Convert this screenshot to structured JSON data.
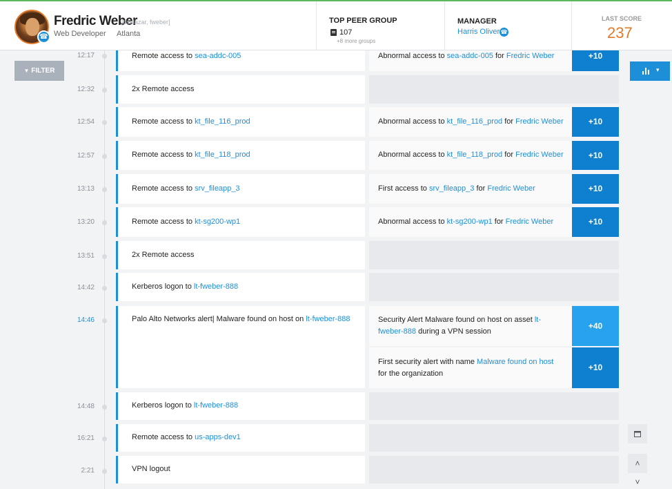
{
  "user": {
    "name": "Fredric Weber",
    "aliases": "[bsalazar, fweber]",
    "role": "Web Developer",
    "location": "Atlanta"
  },
  "peer_group": {
    "title": "TOP PEER GROUP",
    "count": "107",
    "more": "+8 more groups"
  },
  "manager": {
    "title": "MANAGER",
    "name": "Harris Oliver"
  },
  "score": {
    "title": "LAST SCORE",
    "value": "237"
  },
  "filter": {
    "label": "FILTER"
  },
  "events": [
    {
      "time": "12:17",
      "text": "Remote access to ",
      "link": "sea-addc-005"
    },
    {
      "time": "12:32",
      "text": "2x Remote access",
      "link": ""
    },
    {
      "time": "12:54",
      "text": "Remote access to ",
      "link": "kt_file_116_prod"
    },
    {
      "time": "12:57",
      "text": "Remote access to ",
      "link": "kt_file_118_prod"
    },
    {
      "time": "13:13",
      "text": "Remote access to ",
      "link": "srv_fileapp_3"
    },
    {
      "time": "13:20",
      "text": "Remote access to ",
      "link": "kt-sg200-wp1"
    },
    {
      "time": "13:51",
      "text": "2x Remote access",
      "link": ""
    },
    {
      "time": "14:42",
      "text": "Kerberos logon to ",
      "link": "lt-fweber-888"
    },
    {
      "time": "14:46",
      "text": "Palo Alto Networks alert| Malware found on host on ",
      "link": "lt-fweber-888"
    },
    {
      "time": "14:48",
      "text": "Kerberos logon to ",
      "link": "lt-fweber-888"
    },
    {
      "time": "16:21",
      "text": "Remote access to ",
      "link": "us-apps-dev1"
    },
    {
      "time": "2:21",
      "text": "VPN logout",
      "link": ""
    }
  ],
  "alerts": [
    {
      "a": "Abnormal access to ",
      "asset": "sea-addc-005",
      "b": " for ",
      "user": "Fredric Weber",
      "score": "+10"
    },
    {
      "a": "Abnormal access to ",
      "asset": "kt_file_116_prod",
      "b": " for ",
      "user": "Fredric Weber",
      "score": "+10"
    },
    {
      "a": "Abnormal access to ",
      "asset": "kt_file_118_prod",
      "b": " for ",
      "user": "Fredric Weber",
      "score": "+10"
    },
    {
      "a": "First access to ",
      "asset": "srv_fileapp_3",
      "b": " for ",
      "user": "Fredric Weber",
      "score": "+10"
    },
    {
      "a": "Abnormal access to ",
      "asset": "kt-sg200-wp1",
      "b": " for ",
      "user": "Fredric Weber",
      "score": "+10"
    },
    {
      "a": "Security Alert Malware found on host on asset ",
      "asset": "lt-fweber-888",
      "b": " during a VPN session",
      "user": "",
      "score": "+40"
    },
    {
      "a": "First security alert with name ",
      "asset": "Malware found on host",
      "b": " for the organization",
      "user": "",
      "score": "+10"
    }
  ],
  "icons": {
    "phone": "☎",
    "calendar": "calendar-icon",
    "up": "˄",
    "down": "˅",
    "chevron": "▾"
  }
}
